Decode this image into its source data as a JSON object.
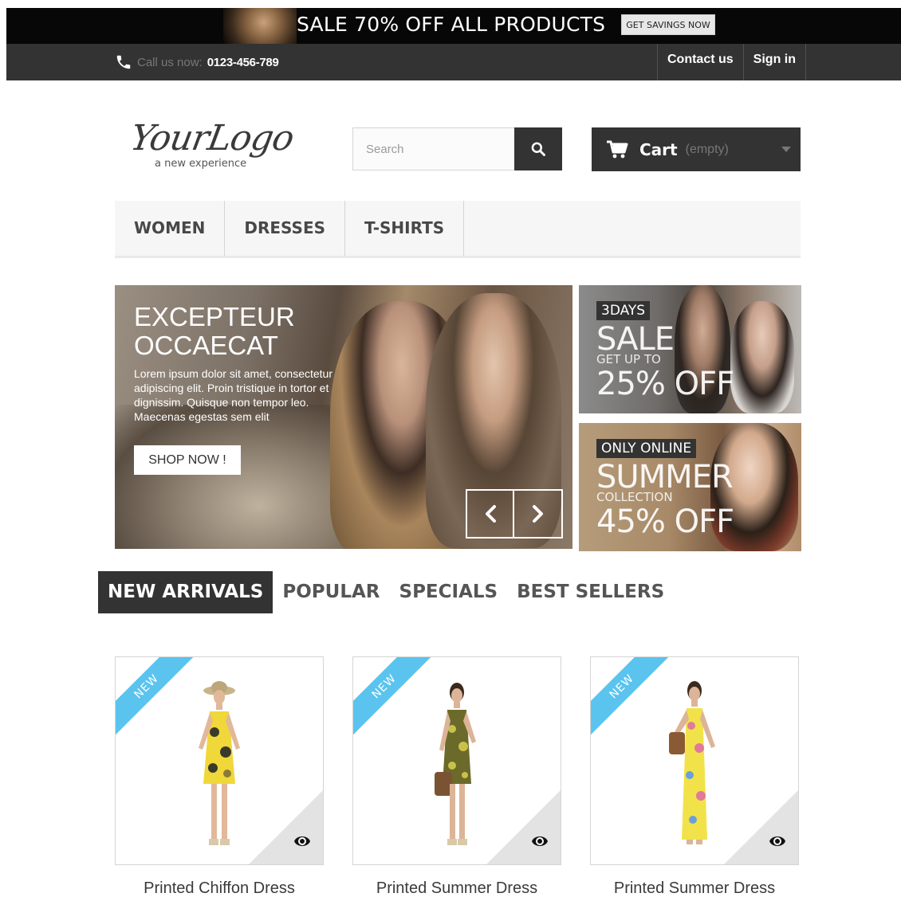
{
  "promo": {
    "text": "SALE 70% OFF ALL PRODUCTS",
    "button": "GET SAVINGS NOW"
  },
  "navbar": {
    "call_label": "Call us now:",
    "phone": "0123-456-789",
    "links": [
      "Contact us",
      "Sign in"
    ]
  },
  "header": {
    "logo_text": "YourLogo",
    "tagline": "a new experience",
    "search_placeholder": "Search",
    "cart_label": "Cart",
    "cart_status": "(empty)"
  },
  "menu": [
    "WOMEN",
    "DRESSES",
    "T-SHIRTS"
  ],
  "slider": {
    "title_line1": "EXCEPTEUR",
    "title_line2": "OCCAECAT",
    "description": "Lorem ipsum dolor sit amet, consectetur adipiscing elit. Proin tristique in tortor et dignissim. Quisque non tempor leo. Maecenas egestas sem elit",
    "button": "SHOP NOW !"
  },
  "banners": [
    {
      "tag": "3DAYS",
      "headline": "SALE",
      "subline": "GET UP TO",
      "offer": "25% OFF"
    },
    {
      "tag": "ONLY ONLINE",
      "headline": "SUMMER",
      "subline": "COLLECTION",
      "offer": "45% OFF"
    }
  ],
  "tabs": [
    "NEW ARRIVALS",
    "POPULAR",
    "SPECIALS",
    "BEST SELLERS"
  ],
  "products": [
    {
      "badge": "NEW",
      "name": "Printed Chiffon Dress",
      "dress_color": "#f0d73a",
      "accent": "#8a7a3a"
    },
    {
      "badge": "NEW",
      "name": "Printed Summer Dress",
      "dress_color": "#6b6a2a",
      "accent": "#c9c24a"
    },
    {
      "badge": "NEW",
      "name": "Printed Summer Dress",
      "dress_color": "#f2e24a",
      "accent": "#e07a9a"
    }
  ],
  "colors": {
    "dark": "#333333",
    "ribbon": "#5ac4ef",
    "menu_bg": "#f6f6f6"
  }
}
